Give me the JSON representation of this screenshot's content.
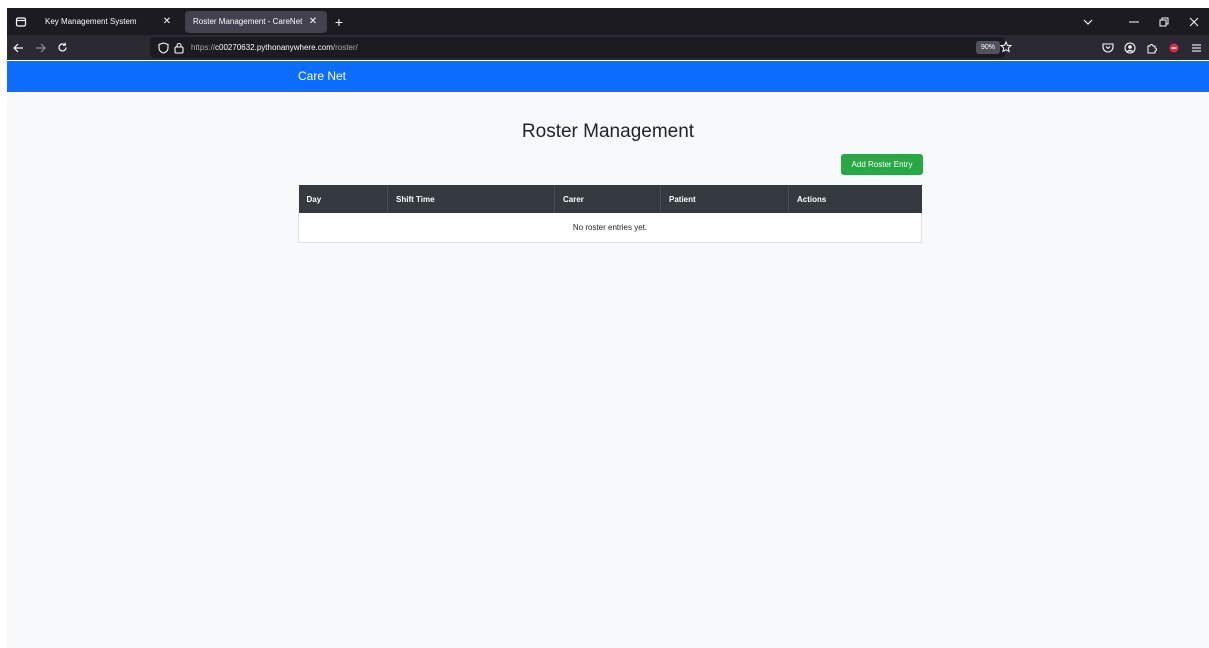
{
  "browser": {
    "tabs": [
      {
        "title": "Key Management System",
        "active": false
      },
      {
        "title": "Roster Management - CareNet",
        "active": true
      }
    ],
    "url": {
      "scheme": "https://",
      "host": "c00270632.pythonanywhere.com",
      "path": "/roster/"
    },
    "zoom": "90%"
  },
  "site": {
    "brand": "Care Net",
    "nav_color": "#0d6efd"
  },
  "page": {
    "title": "Roster Management",
    "add_button": "Add Roster Entry",
    "table": {
      "columns": [
        "Day",
        "Shift Time",
        "Carer",
        "Patient",
        "Actions"
      ],
      "empty_message": "No roster entries yet."
    }
  },
  "colors": {
    "add_button": "#28a745",
    "table_header": "#343a40"
  }
}
